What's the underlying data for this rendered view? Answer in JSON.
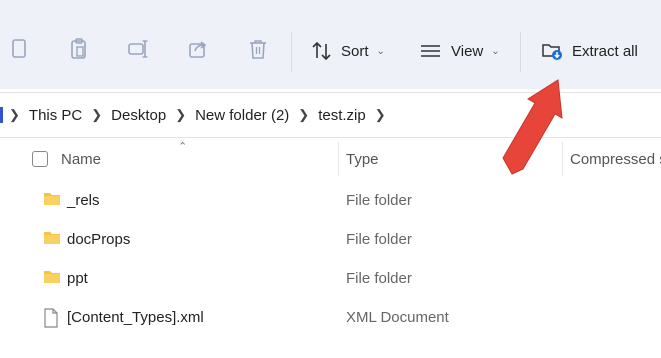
{
  "toolbar": {
    "sort_label": "Sort",
    "view_label": "View",
    "extract_label": "Extract all"
  },
  "breadcrumb": [
    "This PC",
    "Desktop",
    "New folder (2)",
    "test.zip"
  ],
  "columns": {
    "name": "Name",
    "type": "Type",
    "compressed": "Compressed s"
  },
  "files": [
    {
      "name": "_rels",
      "type": "File folder",
      "icon": "folder-icon"
    },
    {
      "name": "docProps",
      "type": "File folder",
      "icon": "folder-icon"
    },
    {
      "name": "ppt",
      "type": "File folder",
      "icon": "folder-icon"
    },
    {
      "name": "[Content_Types].xml",
      "type": "XML Document",
      "icon": "file-icon"
    }
  ],
  "colors": {
    "toolbar_bg": "#eef1f7",
    "folder": "#f5c542",
    "accent": "#1a6fd6",
    "arrow": "#e8453a"
  }
}
